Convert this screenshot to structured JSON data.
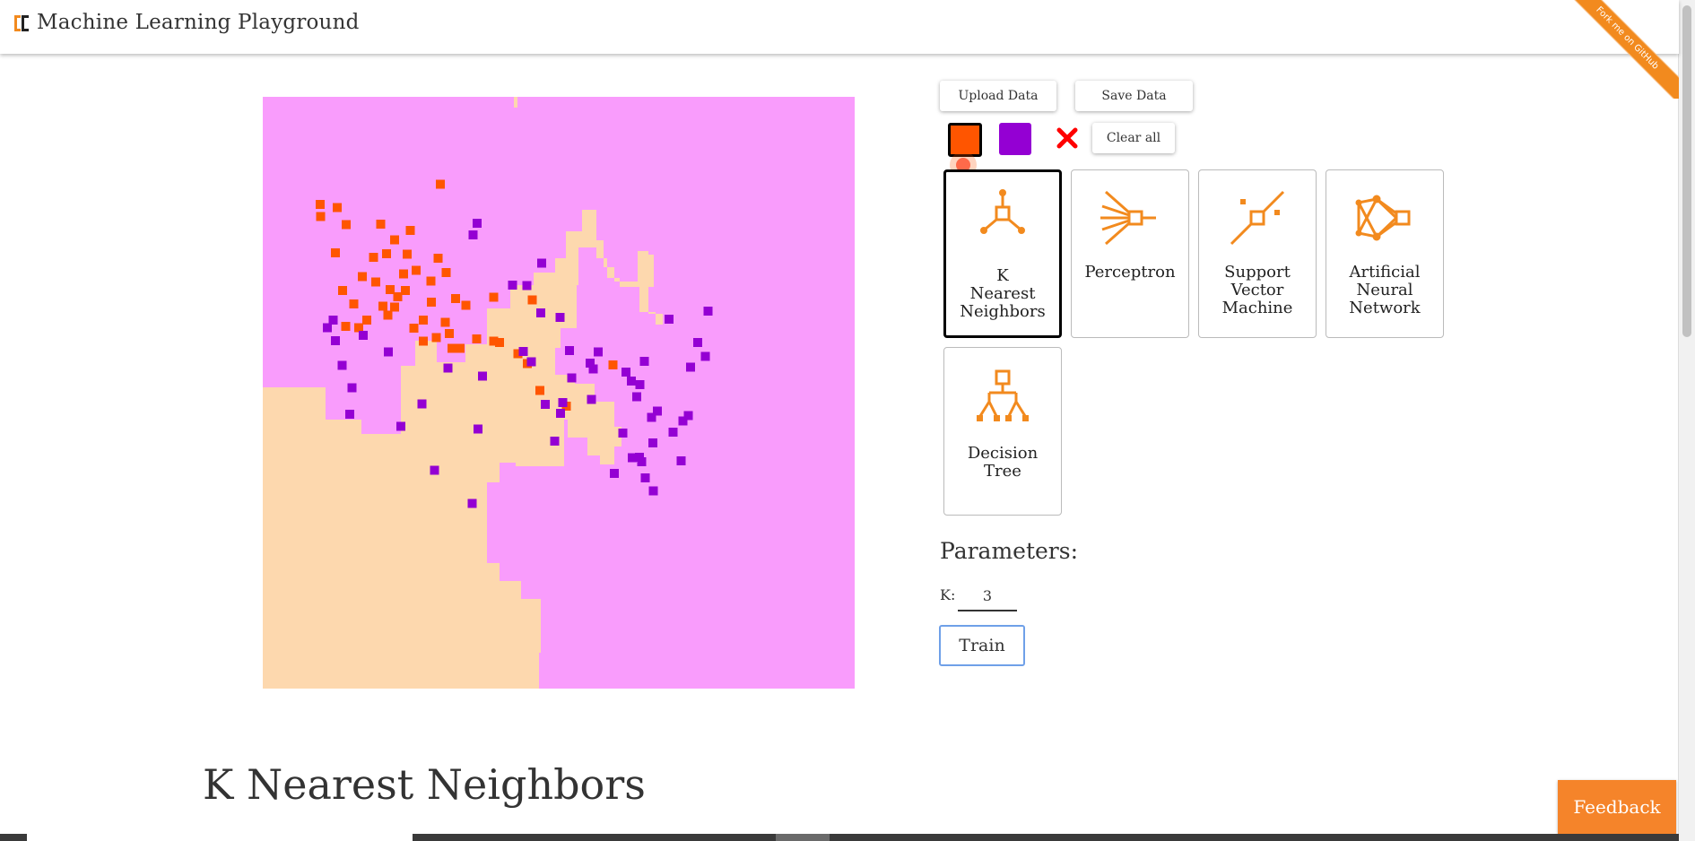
{
  "header": {
    "title": "Machine Learning Playground",
    "ribbon_text": "Fork me on GitHub",
    "accent_color": "#f28a1e"
  },
  "data_controls": {
    "upload_label": "Upload Data",
    "save_label": "Save Data",
    "clear_label": "Clear all",
    "selected_class": "orange",
    "class_colors": {
      "orange": "#ff5500",
      "purple": "#9400d3"
    },
    "delete_icon": "red-x-icon"
  },
  "algorithms": [
    {
      "label": "K Nearest Neighbors",
      "icon": "knn-icon",
      "selected": true
    },
    {
      "label": "Perceptron",
      "icon": "perceptron-icon",
      "selected": false
    },
    {
      "label": "Support Vector Machine",
      "icon": "svm-icon",
      "selected": false
    },
    {
      "label": "Artificial Neural Network",
      "icon": "neural-network-icon",
      "selected": false
    },
    {
      "label": "Decision Tree",
      "icon": "decision-tree-icon",
      "selected": false
    }
  ],
  "parameters": {
    "title": "Parameters:",
    "k_label": "K:",
    "k_value": "3",
    "train_label": "Train"
  },
  "section_heading": "K Nearest Neighbors",
  "feedback_label": "Feedback",
  "plot": {
    "region_colors": {
      "orange": "#fdd8ae",
      "purple": "#f99cfc"
    },
    "point_colors": {
      "orange": "#ff5500",
      "purple": "#9400d3"
    },
    "points": {
      "orange": [
        [
          46.8,
          49.6
        ],
        [
          43.1,
          43.4
        ],
        [
          40.0,
          41.5
        ],
        [
          51.3,
          52.3
        ],
        [
          27.1,
          37.7
        ],
        [
          39.0,
          41.3
        ],
        [
          59.2,
          45.3
        ],
        [
          44.7,
          45.1
        ],
        [
          36.1,
          40.9
        ],
        [
          17.6,
          37.7
        ],
        [
          34.3,
          35.2
        ],
        [
          45.5,
          34.3
        ],
        [
          39.0,
          33.9
        ],
        [
          29.6,
          27.3
        ],
        [
          9.8,
          20.2
        ],
        [
          9.7,
          18.2
        ],
        [
          12.6,
          18.7
        ],
        [
          19.9,
          21.5
        ],
        [
          14.1,
          21.6
        ],
        [
          24.9,
          22.6
        ],
        [
          31.0,
          29.7
        ],
        [
          20.9,
          26.5
        ],
        [
          22.3,
          24.2
        ],
        [
          24.4,
          26.6
        ],
        [
          18.7,
          27.1
        ],
        [
          12.3,
          26.4
        ],
        [
          25.9,
          29.3
        ],
        [
          28.4,
          31.1
        ],
        [
          32.6,
          34.1
        ],
        [
          22.8,
          33.8
        ],
        [
          28.5,
          34.7
        ],
        [
          21.5,
          32.6
        ],
        [
          16.8,
          30.4
        ],
        [
          19.1,
          31.3
        ],
        [
          13.5,
          32.7
        ],
        [
          24.1,
          32.7
        ],
        [
          20.3,
          35.4
        ],
        [
          22.3,
          35.5
        ],
        [
          30.0,
          14.8
        ],
        [
          15.4,
          35.0
        ],
        [
          23.8,
          29.9
        ],
        [
          21.1,
          36.9
        ],
        [
          14.0,
          38.8
        ],
        [
          16.2,
          39.0
        ],
        [
          27.1,
          41.3
        ],
        [
          25.5,
          39.1
        ],
        [
          30.8,
          38.1
        ],
        [
          31.5,
          40.0
        ],
        [
          29.3,
          40.7
        ],
        [
          32.0,
          42.5
        ],
        [
          33.3,
          42.5
        ]
      ],
      "purple": [
        [
          52.2,
          47.5
        ],
        [
          55.5,
          51.1
        ],
        [
          49.3,
          58.2
        ],
        [
          62.3,
          48.0
        ],
        [
          56.7,
          43.1
        ],
        [
          55.8,
          46.0
        ],
        [
          65.7,
          54.2
        ],
        [
          63.2,
          50.7
        ],
        [
          64.5,
          44.7
        ],
        [
          61.4,
          46.5
        ],
        [
          47.1,
          28.1
        ],
        [
          44.6,
          31.9
        ],
        [
          45.4,
          44.8
        ],
        [
          59.4,
          63.6
        ],
        [
          60.8,
          56.8
        ],
        [
          62.4,
          61.0
        ],
        [
          71.0,
          54.8
        ],
        [
          63.6,
          60.9
        ],
        [
          64.6,
          64.4
        ],
        [
          66.7,
          53.1
        ],
        [
          65.9,
          58.5
        ],
        [
          69.3,
          56.7
        ],
        [
          66.0,
          66.6
        ],
        [
          64.0,
          61.7
        ],
        [
          70.7,
          61.5
        ],
        [
          71.9,
          53.9
        ],
        [
          72.3,
          45.7
        ],
        [
          74.8,
          43.9
        ],
        [
          73.5,
          41.5
        ],
        [
          75.2,
          36.2
        ],
        [
          68.6,
          37.6
        ],
        [
          63.7,
          48.6
        ],
        [
          55.3,
          45.0
        ],
        [
          47.7,
          52.0
        ],
        [
          50.3,
          53.5
        ],
        [
          50.7,
          51.7
        ],
        [
          51.8,
          42.9
        ],
        [
          50.2,
          37.3
        ],
        [
          47.0,
          36.5
        ],
        [
          44.0,
          43.0
        ],
        [
          42.2,
          31.8
        ],
        [
          37.1,
          47.2
        ],
        [
          36.4,
          56.1
        ],
        [
          35.4,
          68.7
        ],
        [
          29.0,
          63.1
        ],
        [
          31.3,
          45.8
        ],
        [
          23.3,
          55.7
        ],
        [
          21.2,
          43.1
        ],
        [
          26.9,
          51.9
        ],
        [
          17.0,
          40.3
        ],
        [
          14.7,
          53.6
        ],
        [
          15.1,
          49.2
        ],
        [
          13.4,
          45.4
        ],
        [
          12.3,
          41.2
        ],
        [
          11.9,
          37.7
        ],
        [
          10.9,
          39.0
        ],
        [
          36.2,
          21.4
        ],
        [
          35.5,
          23.3
        ]
      ]
    }
  }
}
